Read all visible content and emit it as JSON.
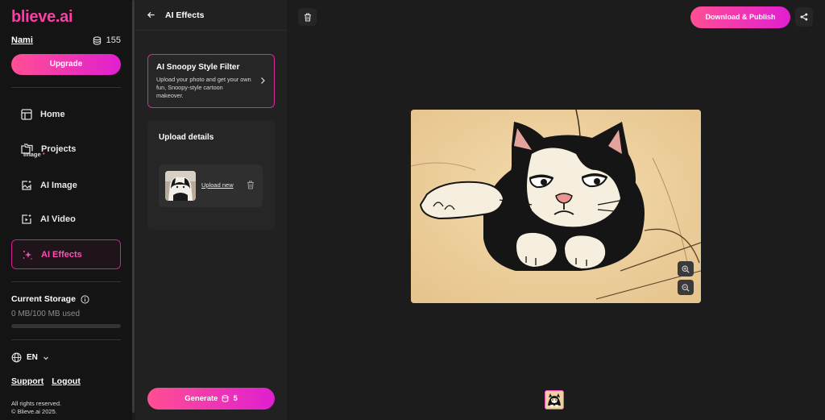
{
  "brand": {
    "logo": "blieve.ai",
    "accent": "#ff4fb5"
  },
  "user": {
    "name": "Nami",
    "credits": "155"
  },
  "sidebar": {
    "upgrade_label": "Upgrade",
    "items": [
      {
        "label": "Home",
        "icon": "layout-icon"
      },
      {
        "label": "Projects",
        "icon": "folders-icon"
      },
      {
        "label": "AI Image",
        "icon": "image-sparkle-icon"
      },
      {
        "label": "AI Video",
        "icon": "video-sparkle-icon"
      },
      {
        "label": "AI Effects",
        "icon": "sparkles-icon",
        "active": true
      }
    ],
    "storage": {
      "title": "Current Storage",
      "used": "0 MB/100 MB used",
      "fraction": 0
    },
    "language": "EN",
    "links": {
      "support": "Support",
      "logout": "Logout"
    },
    "footer": {
      "line1": "All rights reserved.",
      "line2": "© Blieve.ai 2025."
    }
  },
  "panel": {
    "title": "AI Effects",
    "filter": {
      "title": "AI Snoopy Style Filter",
      "description": "Upload your photo and get your own fun, Snoopy-style cartoon makeover."
    },
    "upload": {
      "title": "Upload details",
      "image_label": "Image",
      "required_mark": "*",
      "upload_new": "Upload new"
    },
    "generate": {
      "label": "Generate",
      "cost": "5"
    }
  },
  "canvas": {
    "publish_label": "Download & Publish"
  }
}
